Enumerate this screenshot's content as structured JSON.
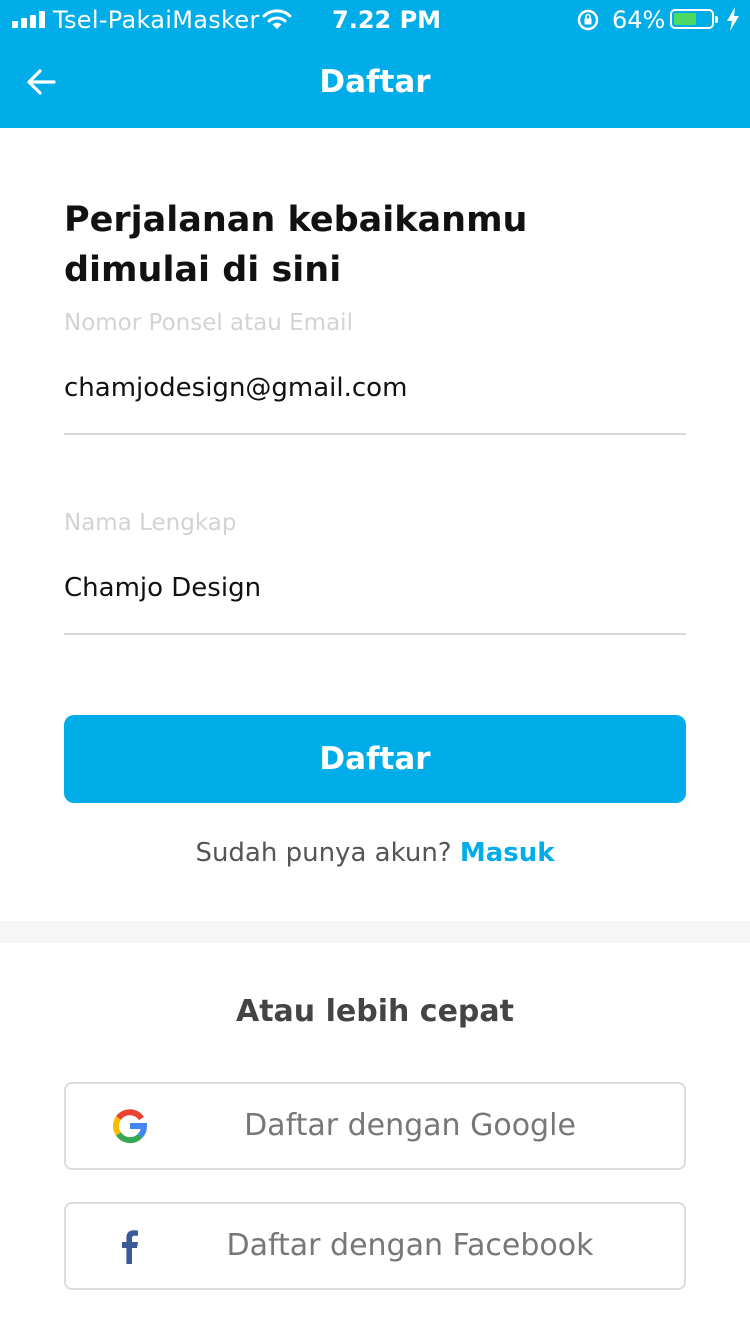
{
  "status_bar": {
    "carrier": "Tsel-PakaiMasker",
    "time": "7.22 PM",
    "battery_percent": "64%",
    "battery_level": 0.64,
    "signal_bars": 4
  },
  "header": {
    "title": "Daftar",
    "back_icon": "arrow-left-icon"
  },
  "form": {
    "headline": "Perjalanan kebaikanmu dimulai di sini",
    "fields": [
      {
        "label": "Nomor Ponsel atau Email",
        "value": "chamjodesign@gmail.com"
      },
      {
        "label": "Nama Lengkap",
        "value": "Chamjo Design"
      }
    ],
    "submit_label": "Daftar",
    "login_prompt": "Sudah punya akun?",
    "login_link": "Masuk"
  },
  "alternatives": {
    "title": "Atau lebih cepat",
    "google_label": "Daftar dengan Google",
    "facebook_label": "Daftar dengan Facebook"
  },
  "colors": {
    "primary": "#00ade9",
    "facebook": "#3b5998"
  }
}
